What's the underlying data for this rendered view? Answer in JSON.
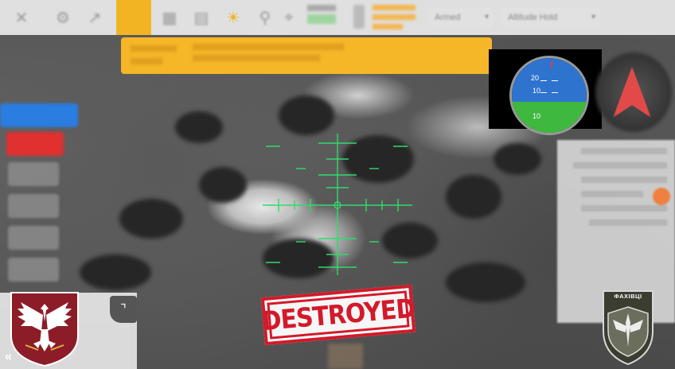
{
  "toolbar": {
    "active_color": "#f3b424",
    "select_1": "Armed",
    "select_2": "Altitude Hold",
    "icons": [
      "menu-icon",
      "settings-icon",
      "chart-icon",
      "plan-icon",
      "list-icon",
      "vehicle-icon",
      "sun-icon",
      "signal-icon",
      "telemetry-icon",
      "battery-icon"
    ]
  },
  "attitude": {
    "pitch_labels": [
      "20",
      "10",
      "10"
    ],
    "sky_color": "#2e74cf",
    "ground_color": "#3fb83f"
  },
  "stamp": {
    "text": "DESTROYED",
    "color": "#d21a2a"
  },
  "emblem_right": {
    "label": "ФАХІВЦІ"
  },
  "emblem_left": {
    "arrow": "«"
  }
}
